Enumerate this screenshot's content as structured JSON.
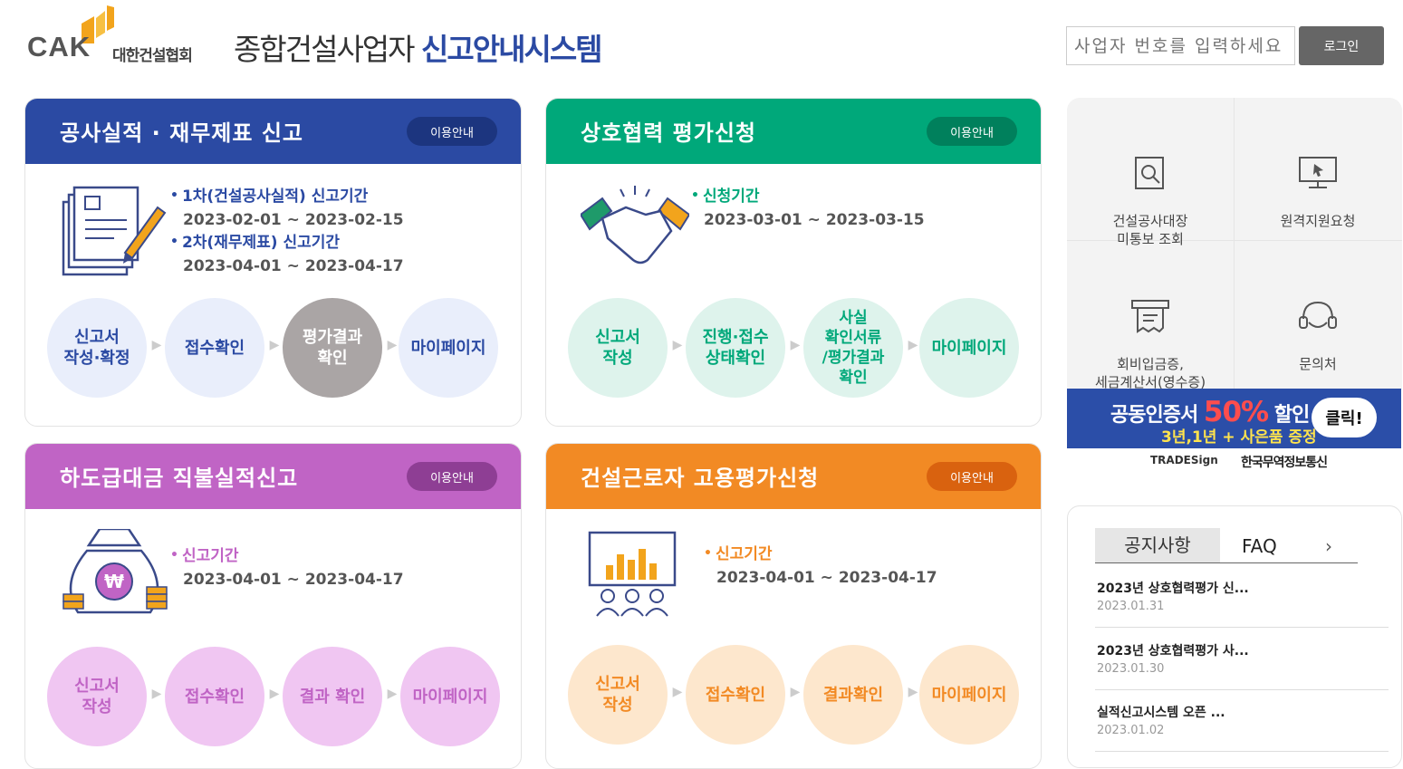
{
  "header": {
    "logo_text": "CAK",
    "logo_org": "대한건설협회",
    "site_title_plain": "종합건설사업자 ",
    "site_title_bold": "신고안내시스템",
    "business_input_placeholder": "사업자 번호를 입력하세요",
    "login_label": "로그인"
  },
  "cards": [
    {
      "title": "공사실적 · 재무제표 신고",
      "guide_label": "이용안내",
      "color": "#2b4aa3",
      "icon": "document-pen-icon",
      "periods": [
        {
          "label": "1차(건설공사실적) 신고기간",
          "range": "2023-02-01 ~ 2023-02-15"
        },
        {
          "label": "2차(재무제표) 신고기간",
          "range": "2023-04-01 ~ 2023-04-17"
        }
      ],
      "steps": [
        "신고서\n작성·확정",
        "접수확인",
        "평가결과\n확인",
        "마이페이지"
      ]
    },
    {
      "title": "상호협력 평가신청",
      "guide_label": "이용안내",
      "color": "#00a87a",
      "icon": "handshake-icon",
      "periods": [
        {
          "label": "신청기간",
          "range": "2023-03-01 ~ 2023-03-15"
        }
      ],
      "steps": [
        "신고서\n작성",
        "진행·접수\n상태확인",
        "사실\n확인서류\n/평가결과\n확인",
        "마이페이지"
      ]
    },
    {
      "title": "하도급대금 직불실적신고",
      "guide_label": "이용안내",
      "color": "#c064c5",
      "icon": "money-bag-icon",
      "periods": [
        {
          "label": "신고기간",
          "range": "2023-04-01 ~ 2023-04-17"
        }
      ],
      "steps": [
        "신고서\n작성",
        "접수확인",
        "결과 확인",
        "마이페이지"
      ]
    },
    {
      "title": "건설근로자 고용평가신청",
      "guide_label": "이용안내",
      "color": "#f28a24",
      "icon": "presentation-icon",
      "periods": [
        {
          "label": "신고기간",
          "range": "2023-04-01 ~ 2023-04-17"
        }
      ],
      "steps": [
        "신고서\n작성",
        "접수확인",
        "결과확인",
        "마이페이지"
      ]
    }
  ],
  "side_menu": [
    {
      "label": "건설공사대장\n미통보 조회",
      "icon": "search-document-icon"
    },
    {
      "label": "원격지원요청",
      "icon": "remote-monitor-icon"
    },
    {
      "label": "회비입금증,\n세금계산서(영수증)",
      "icon": "receipt-icon"
    },
    {
      "label": "문의처",
      "icon": "headset-icon"
    }
  ],
  "banner": {
    "line1": "공동인증서 ",
    "line1_highlight": "50%",
    "line1_tail": " 할인",
    "line2": "3년,1년 + 사은품 증정",
    "click": "클릭!",
    "brand1": "TRADESign",
    "brand2": "한국무역정보통신"
  },
  "notice": {
    "tab_notice": "공지사항",
    "tab_faq": "FAQ",
    "more": "›",
    "items": [
      {
        "title": "2023년 상호협력평가 신...",
        "date": "2023.01.31"
      },
      {
        "title": "2023년 상호협력평가 사...",
        "date": "2023.01.30"
      },
      {
        "title": "실적신고시스템 오픈 ...",
        "date": "2023.01.02"
      }
    ]
  },
  "colors": {
    "blue": "#2b4aa3",
    "green": "#00a87a",
    "purple": "#c064c5",
    "orange": "#f28a24"
  }
}
